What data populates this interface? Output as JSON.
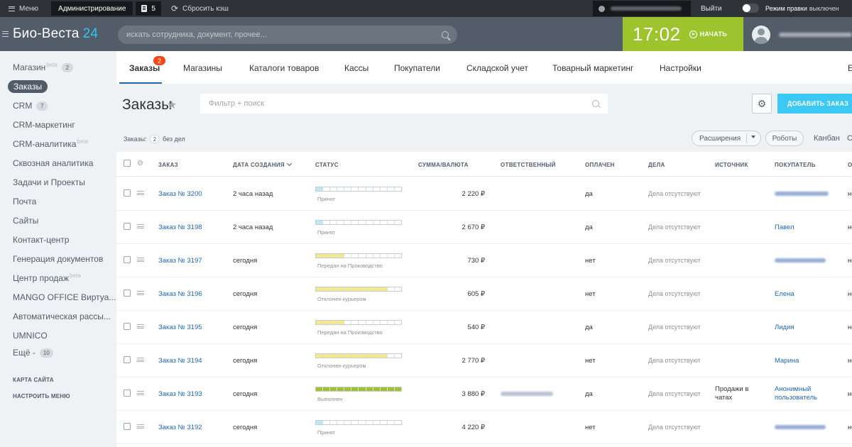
{
  "admin_bar": {
    "menu": "Меню",
    "admin": "Администрирование",
    "count": "5",
    "reset_cache": "Сбросить кэш",
    "exit": "Выйти",
    "edit_mode": "Режим правки",
    "edit_mode_state": "выключен"
  },
  "header": {
    "logo_name": "Био-Веста",
    "logo_num": "24",
    "search_placeholder": "искать сотрудника, документ, прочее...",
    "time": "17:02",
    "start": "НАЧАТЬ"
  },
  "sidebar": {
    "items": [
      {
        "label": "Магазин",
        "sup": "beta",
        "count": "2"
      },
      {
        "label": "Заказы"
      },
      {
        "label": "CRM",
        "count": "7"
      },
      {
        "label": "CRM-маркетинг"
      },
      {
        "label": "CRM-аналитика",
        "sup": "beta"
      },
      {
        "label": "Сквозная аналитика"
      },
      {
        "label": "Задачи и Проекты"
      },
      {
        "label": "Почта"
      },
      {
        "label": "Сайты"
      },
      {
        "label": "Контакт-центр"
      },
      {
        "label": "Генерация документов"
      },
      {
        "label": "Центр продаж",
        "sup": "beta"
      },
      {
        "label": "MANGO OFFICE Виртуа..."
      },
      {
        "label": "Автоматическая рассы..."
      },
      {
        "label": "UMNICO"
      },
      {
        "label": "Ещё -",
        "count": "10"
      }
    ],
    "sitemap": "КАРТА САЙТА",
    "configure": "НАСТРОИТЬ МЕНЮ"
  },
  "tabs": {
    "items": [
      "Заказы",
      "Магазины",
      "Каталоги товаров",
      "Кассы",
      "Покупатели",
      "Складской учет",
      "Товарный маркетинг",
      "Настройки",
      "Е"
    ],
    "badge": "2"
  },
  "toolbar": {
    "title": "Заказы",
    "filter_placeholder": "Фильтр + поиск",
    "add_button": "ДОБАВИТЬ ЗАКАЗ",
    "counter_label": "Заказы:",
    "counter_value": "2",
    "counter_suffix": "без дел",
    "extensions": "Расширения",
    "robots": "Роботы",
    "kanban": "Канбан",
    "list": "С"
  },
  "grid": {
    "columns": [
      "ЗАКАЗ",
      "ДАТА СОЗДАНИЯ",
      "СТАТУС",
      "СУММА/ВАЛЮТА",
      "ОТВЕТСТВЕННЫЙ",
      "ОПЛАЧЕН",
      "ДЕЛА",
      "ИСТОЧНИК",
      "ПОКУПАТЕЛЬ",
      "О"
    ],
    "rows": [
      {
        "order": "Заказ № 3200",
        "date": "2 часа назад",
        "status": "Принят",
        "progress": 1,
        "color": "#bde8f5",
        "sum": "2 220 ₽",
        "paid": "да",
        "tasks": "Дела отсутствуют",
        "source": "",
        "source2": "",
        "buyer": "",
        "buyer2": "",
        "trail": "не"
      },
      {
        "order": "Заказ № 3198",
        "date": "2 часа назад",
        "status": "Принят",
        "progress": 1,
        "color": "#bde8f5",
        "sum": "2 670 ₽",
        "paid": "да",
        "tasks": "Дела отсутствуют",
        "source": "",
        "source2": "",
        "buyer": "Павел",
        "buyer2": "",
        "trail": "не"
      },
      {
        "order": "Заказ № 3197",
        "date": "сегодня",
        "status": "Передан на Производство",
        "progress": 4,
        "color": "#f4ea8a",
        "sum": "730 ₽",
        "paid": "нет",
        "tasks": "Дела отсутствуют",
        "source": "",
        "source2": "",
        "buyer": "",
        "buyer2": "",
        "trail": "не"
      },
      {
        "order": "Заказ № 3196",
        "date": "сегодня",
        "status": "Отклонен курьером",
        "progress": 10,
        "color": "#f4ea8a",
        "sum": "605 ₽",
        "paid": "нет",
        "tasks": "Дела отсутствуют",
        "source": "",
        "source2": "",
        "buyer": "Елена",
        "buyer2": "",
        "trail": "не"
      },
      {
        "order": "Заказ № 3195",
        "date": "сегодня",
        "status": "Передан на Производство",
        "progress": 4,
        "color": "#f4ea8a",
        "sum": "540 ₽",
        "paid": "да",
        "tasks": "Дела отсутствуют",
        "source": "",
        "source2": "",
        "buyer": "Лидия",
        "buyer2": "",
        "trail": "не"
      },
      {
        "order": "Заказ № 3194",
        "date": "сегодня",
        "status": "Отклонен курьером",
        "progress": 10,
        "color": "#f4ea8a",
        "sum": "2 770 ₽",
        "paid": "нет",
        "tasks": "Дела отсутствуют",
        "source": "",
        "source2": "",
        "buyer": "Марина",
        "buyer2": "",
        "trail": "не"
      },
      {
        "order": "Заказ № 3193",
        "date": "сегодня",
        "status": "Выполнен",
        "progress": 12,
        "color": "#9dc42d",
        "sum": "3 880 ₽",
        "paid": "да",
        "tasks": "Дела отсутствуют",
        "source": "Продажи в",
        "source2": "чатах",
        "buyer": "Анонимный",
        "buyer2": "пользователь",
        "trail": "не"
      },
      {
        "order": "Заказ № 3192",
        "date": "сегодня",
        "status": "Принят",
        "progress": 1,
        "color": "#bde8f5",
        "sum": "4 220 ₽",
        "paid": "нет",
        "tasks": "Дела отсутствуют",
        "source": "",
        "source2": "",
        "buyer": "",
        "buyer2": "",
        "trail": "не"
      }
    ]
  }
}
